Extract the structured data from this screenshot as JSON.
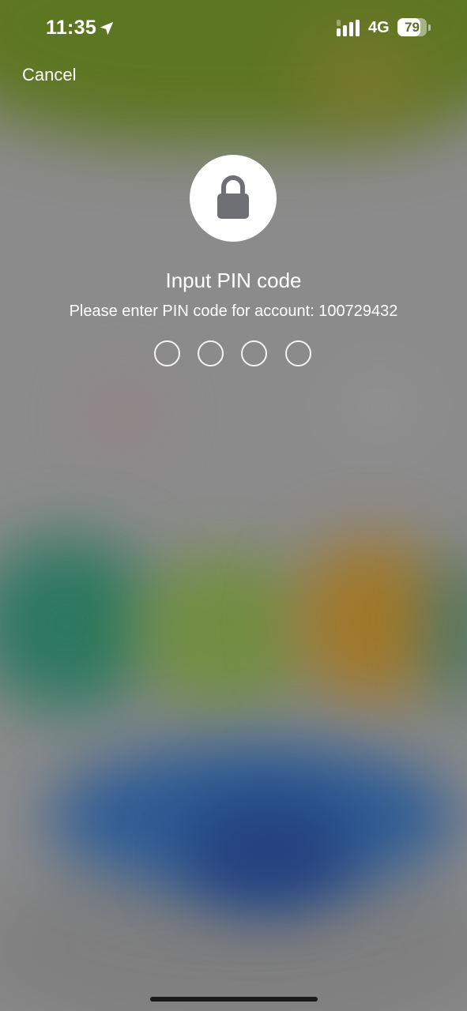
{
  "status_bar": {
    "time": "11:35",
    "location_icon": "location-arrow-icon",
    "signal_icon": "cellular-signal-icon",
    "network": "4G",
    "battery_level": "79",
    "battery_fraction": 0.79
  },
  "nav": {
    "cancel_label": "Cancel"
  },
  "pin_prompt": {
    "icon": "lock-icon",
    "title": "Input PIN code",
    "subtitle": "Please enter PIN code for account: 100729432",
    "digits_total": 4,
    "digits_entered": 0
  },
  "colors": {
    "lock_badge": "#ffffff",
    "lock_glyph": "#6e7074",
    "accent_top": "#5d7622"
  }
}
